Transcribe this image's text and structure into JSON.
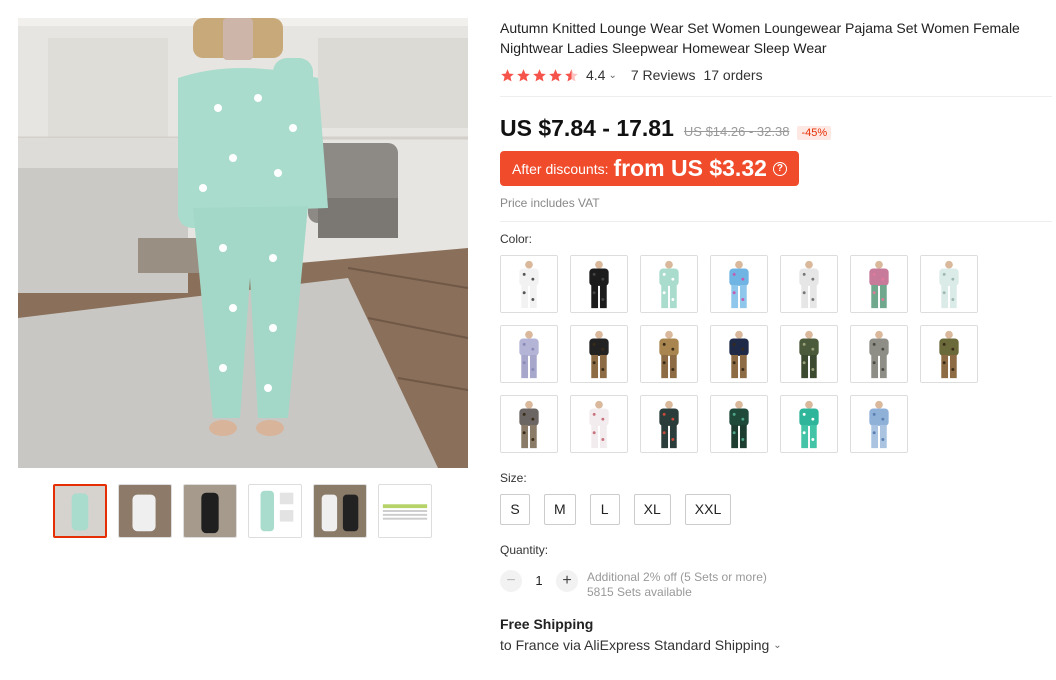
{
  "product": {
    "title": "Autumn Knitted Lounge Wear Set Women Loungewear Pajama Set Women Female Nightwear Ladies Sleepwear Homewear Sleep Wear",
    "rating": "4.4",
    "rating_value": 4.4,
    "reviews": "7 Reviews",
    "orders": "17 orders"
  },
  "price": {
    "current": "US $7.84 - 17.81",
    "original": "US $14.26 - 32.38",
    "discount_pct": "-45%",
    "after_discounts_label": "After discounts:",
    "after_discounts_amount": "from US $3.32",
    "help_icon": "question-circle-icon",
    "vat_note": "Price includes VAT"
  },
  "color": {
    "label": "Color:",
    "swatches": [
      {
        "name": "white-stars",
        "top": "#f2f2f2",
        "bottom": "#f2f2f2",
        "accent": "#555"
      },
      {
        "name": "black",
        "top": "#1c1c1c",
        "bottom": "#1c1c1c",
        "accent": "#444"
      },
      {
        "name": "mint-stars",
        "top": "#a9dccd",
        "bottom": "#a9dccd",
        "accent": "#fff"
      },
      {
        "name": "blue-tie-dye",
        "top": "#6fb4e3",
        "bottom": "#8fc6ec",
        "accent": "#c45cb0"
      },
      {
        "name": "grey-white",
        "top": "#e6e6e6",
        "bottom": "#e6e6e6",
        "accent": "#777"
      },
      {
        "name": "pink-tie-dye",
        "top": "#c77a9a",
        "bottom": "#6fa88d",
        "accent": "#e07a9c"
      },
      {
        "name": "light-mint",
        "top": "#dbece8",
        "bottom": "#dbece8",
        "accent": "#9fb8b1"
      },
      {
        "name": "lavender",
        "top": "#b4b4d6",
        "bottom": "#a7a7cb",
        "accent": "#8a8ab8"
      },
      {
        "name": "black-leopard",
        "top": "#222222",
        "bottom": "#8c6b45",
        "accent": "#3a2b18"
      },
      {
        "name": "khaki-leopard",
        "top": "#a9864f",
        "bottom": "#8c6b45",
        "accent": "#3a2b18"
      },
      {
        "name": "navy-leopard",
        "top": "#1e2a48",
        "bottom": "#8c6b45",
        "accent": "#3a2b18"
      },
      {
        "name": "camo",
        "top": "#4a5a3a",
        "bottom": "#3c4a30",
        "accent": "#9aa07a"
      },
      {
        "name": "grey-camo",
        "top": "#8e8e86",
        "bottom": "#8e8e86",
        "accent": "#4a4a42"
      },
      {
        "name": "olive-leopard",
        "top": "#6b6a3a",
        "bottom": "#8c6b45",
        "accent": "#3a2b18"
      },
      {
        "name": "grey-leopard",
        "top": "#6b6663",
        "bottom": "#8a7a68",
        "accent": "#3a2b18"
      },
      {
        "name": "white-floral",
        "top": "#f3ecee",
        "bottom": "#f3ecee",
        "accent": "#c9737f"
      },
      {
        "name": "multi-floral",
        "top": "#2b3d3a",
        "bottom": "#2b3d3a",
        "accent": "#c84a3a"
      },
      {
        "name": "dark-green-floral",
        "top": "#1f4a3a",
        "bottom": "#1c3d30",
        "accent": "#4fa58a"
      },
      {
        "name": "teal-tie-dye",
        "top": "#2fb59a",
        "bottom": "#43c4a6",
        "accent": "#ffffff"
      },
      {
        "name": "blue-pattern",
        "top": "#8fb1d8",
        "bottom": "#a9c3e1",
        "accent": "#5a7fb0"
      }
    ]
  },
  "size": {
    "label": "Size:",
    "options": [
      "S",
      "M",
      "L",
      "XL",
      "XXL"
    ]
  },
  "quantity": {
    "label": "Quantity:",
    "value": "1",
    "minus": "−",
    "plus": "+",
    "bulk_note": "Additional 2% off (5 Sets or more)",
    "available": "5815 Sets available"
  },
  "shipping": {
    "title": "Free Shipping",
    "detail": "to France via AliExpress Standard Shipping"
  },
  "colors": {
    "accent": "#e62e04",
    "discount_bg": "#f04b2b",
    "star": "#f6534a"
  }
}
